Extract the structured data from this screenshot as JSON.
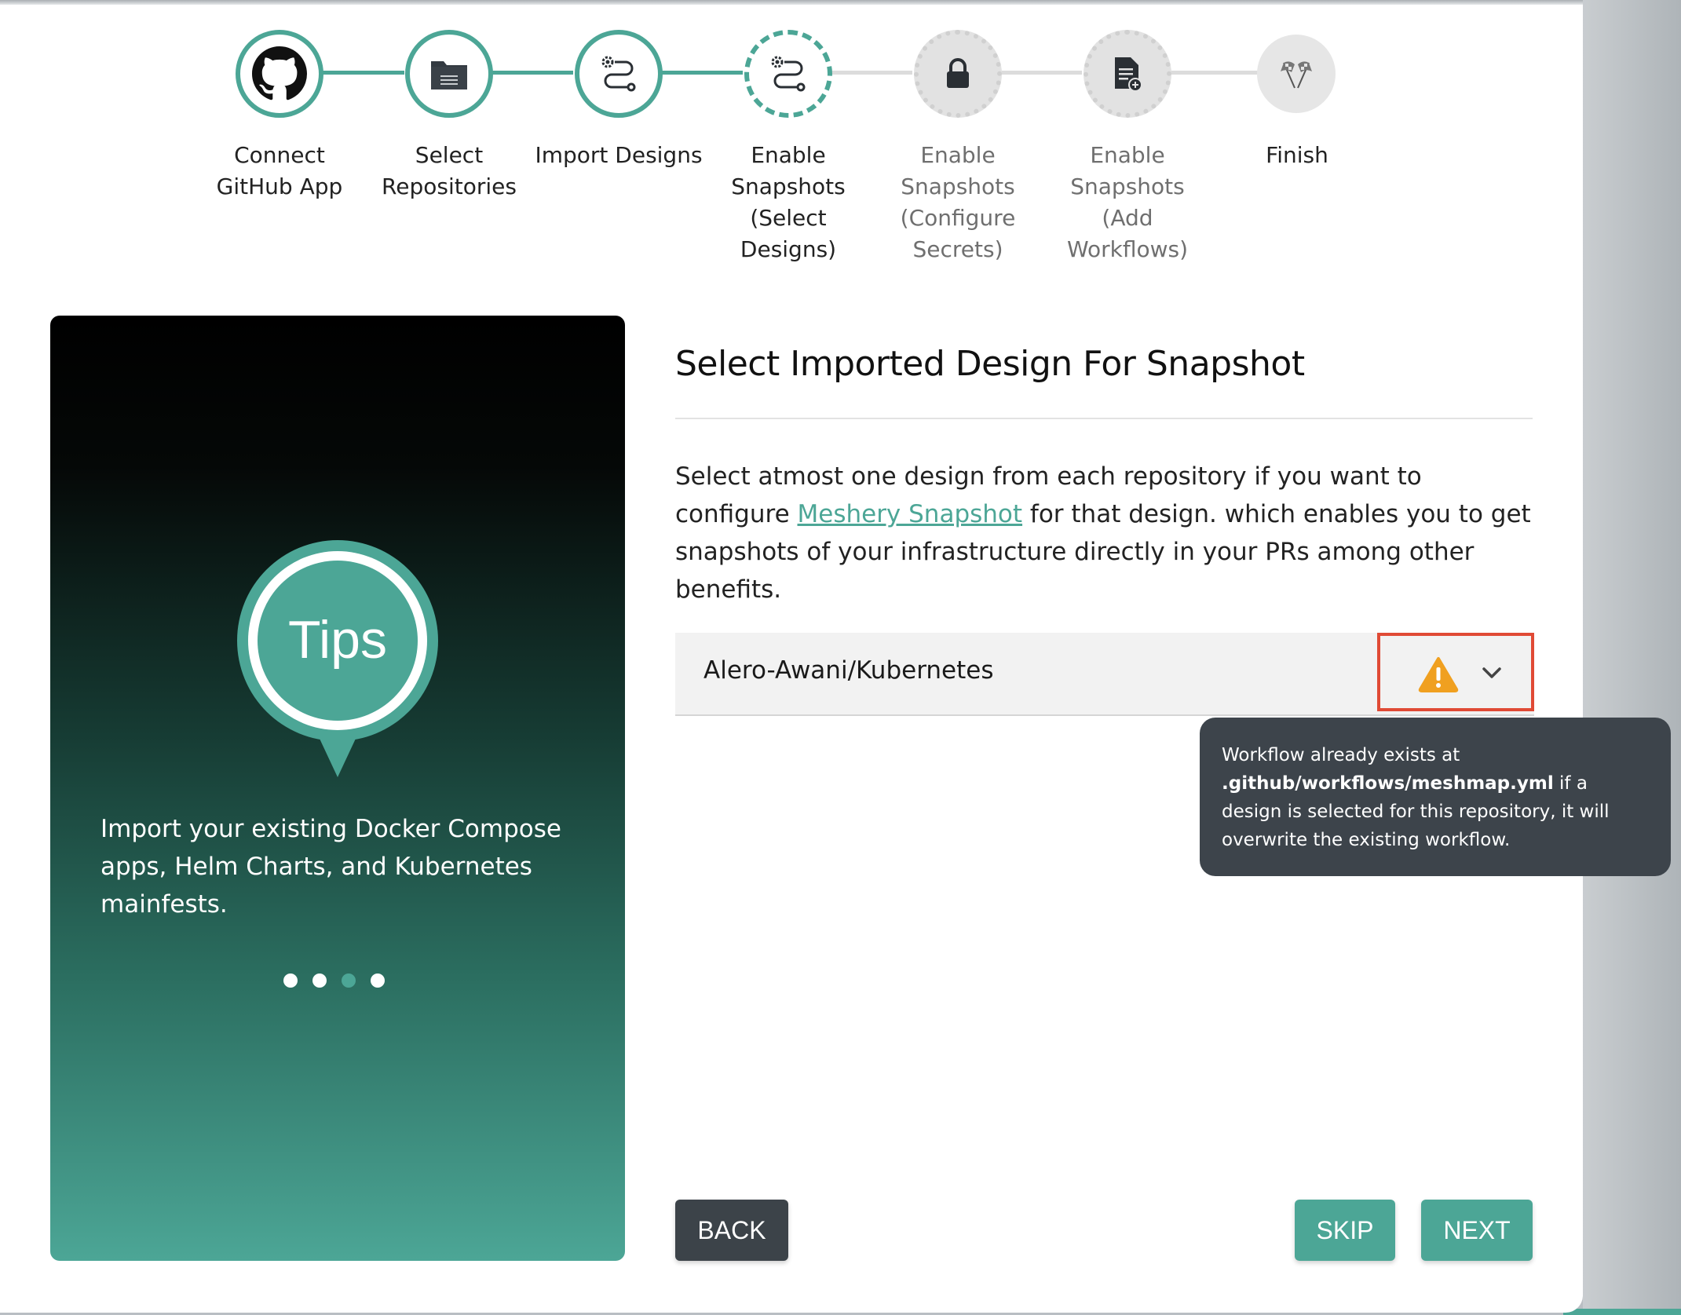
{
  "stepper": {
    "steps": [
      {
        "label": "Connect GitHub App",
        "icon": "github-icon",
        "state": "done"
      },
      {
        "label": "Select Repositories",
        "icon": "folder-icon",
        "state": "done"
      },
      {
        "label": "Import Designs",
        "icon": "route-gear-icon",
        "state": "done"
      },
      {
        "label": "Enable Snapshots (Select Designs)",
        "icon": "route-gear-icon",
        "state": "active"
      },
      {
        "label": "Enable Snapshots (Configure Secrets)",
        "icon": "lock-icon",
        "state": "todo"
      },
      {
        "label": "Enable Snapshots (Add Workflows)",
        "icon": "document-add-icon",
        "state": "todo"
      },
      {
        "label": "Finish",
        "icon": "checkered-flags-icon",
        "state": "todo"
      }
    ]
  },
  "tips": {
    "badge": "Tips",
    "text": "Import your existing Docker Compose apps, Helm Charts, and Kubernetes mainfests.",
    "active_dot": 3,
    "dot_count": 4
  },
  "form": {
    "title": "Select Imported Design For Snapshot",
    "description_before": "Select atmost one design from each repository if you want to configure ",
    "link_text": "Meshery Snapshot",
    "description_after": " for that design. which enables you to get snapshots of your infrastructure directly in your PRs among other benefits.",
    "repo_value": "Alero-Awani/Kubernetes"
  },
  "tooltip": {
    "line_start": "Workflow already exists at ",
    "path": ".github/workflows/meshmap.yml",
    "line_end": " if a design is selected for this repository, it will overwrite the existing workflow."
  },
  "buttons": {
    "back": "BACK",
    "skip": "SKIP",
    "next": "NEXT"
  },
  "colors": {
    "accent": "#4ca696",
    "dark_button": "#3c4349",
    "warning": "#f0a020",
    "highlight_border": "#e04a35",
    "tooltip_bg": "#3d444b"
  }
}
